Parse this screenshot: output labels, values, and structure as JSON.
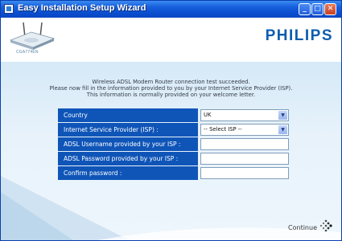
{
  "window": {
    "title": "Easy Installation Setup Wizard",
    "controls": [
      "minimize",
      "maximize",
      "close"
    ]
  },
  "header": {
    "model": "CGA774EN",
    "brand": "PHILIPS"
  },
  "message": {
    "line1": "Wireless ADSL Modem Router connection test succeeded.",
    "line2": "Please now fill in the information provided to you by your Internet Service Provider (ISP).",
    "line3": "This information is normally provided on your welcome letter."
  },
  "form": {
    "country_label": "Country",
    "country_value": "UK",
    "isp_label": "Internet Service Provider (ISP) :",
    "isp_value": "-- Select ISP --",
    "username_label": "ADSL Username provided by your ISP :",
    "username_value": "",
    "password_label": "ADSL Password provided by your ISP :",
    "password_value": "",
    "confirm_label": "Confirm password :",
    "confirm_value": ""
  },
  "footer": {
    "continue_label": "Continue"
  },
  "colors": {
    "titlebar": "#0b4fd0",
    "brand": "#0d5db0",
    "label_bg": "#0f55b8",
    "content_bg": "#d5e9f7"
  },
  "icons": [
    "app-icon",
    "router-image",
    "chevron-down-icon",
    "continue-arrow-icon"
  ]
}
